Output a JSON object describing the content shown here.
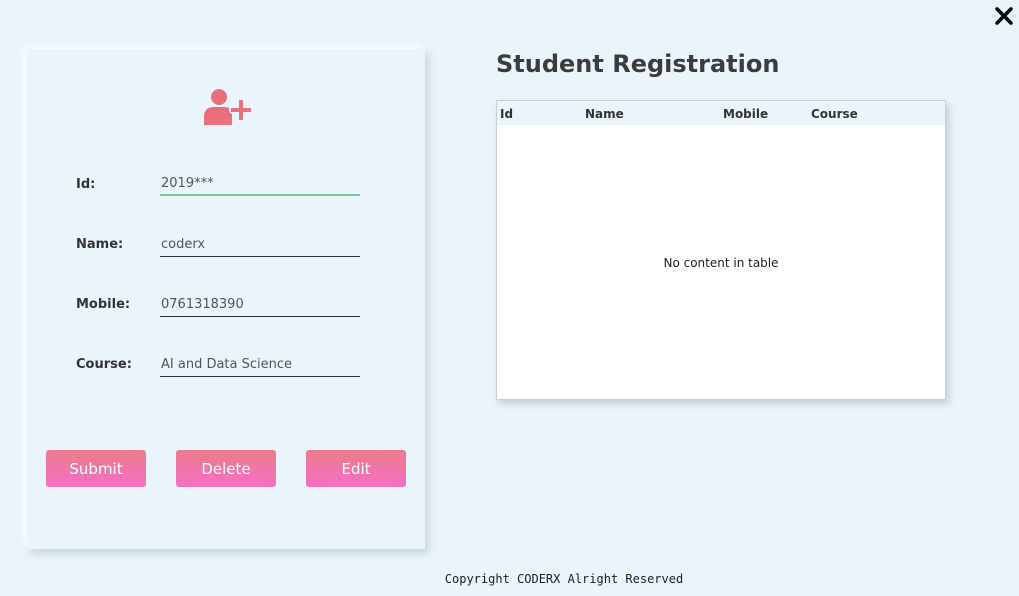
{
  "window": {
    "close_icon": "close-icon"
  },
  "form": {
    "header_icon": "add-user-icon",
    "header_icon_color": "#e96f7b",
    "fields": [
      {
        "label": "Id:",
        "value": "2019***"
      },
      {
        "label": "Name:",
        "value": "coderx"
      },
      {
        "label": "Mobile:",
        "value": "0761318390"
      },
      {
        "label": "Course:",
        "value": "AI and Data Science"
      }
    ],
    "focused_field_color": "#6fcf97",
    "buttons": {
      "submit": "Submit",
      "delete": "Delete",
      "edit": "Edit"
    },
    "button_color": "#f070a8"
  },
  "main": {
    "title": "Student Registration",
    "table": {
      "columns": [
        "Id",
        "Name",
        "Mobile",
        "Course"
      ],
      "rows": [],
      "empty_message": "No content in table"
    }
  },
  "footer": {
    "text": "Copyright CODERX Alright Reserved"
  }
}
